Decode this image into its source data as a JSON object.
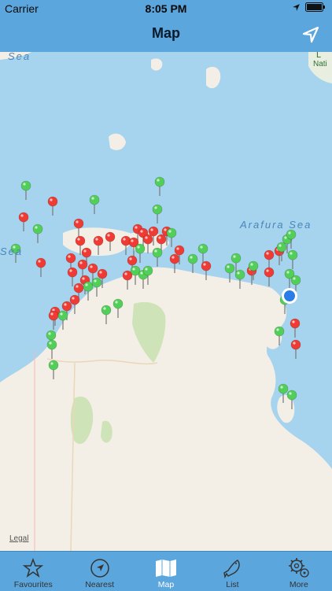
{
  "status": {
    "carrier": "Carrier",
    "time": "8:05 PM"
  },
  "nav": {
    "title": "Map"
  },
  "map": {
    "labels": {
      "sea_left": "Sea",
      "arafura": "Arafura Sea",
      "top_right_1": "L",
      "top_right_2": "Nati",
      "coast_mid": "Sea"
    },
    "legal": "Legal"
  },
  "tabs": [
    {
      "label": "Favourites",
      "icon": "star-icon"
    },
    {
      "label": "Nearest",
      "icon": "compass-icon"
    },
    {
      "label": "Map",
      "icon": "map-icon",
      "active": true
    },
    {
      "label": "List",
      "icon": "fish-icon"
    },
    {
      "label": "More",
      "icon": "gear-icon"
    }
  ],
  "colors": {
    "bar": "#5ba6dd",
    "sea": "#a6d3ee",
    "land": "#f4efe6",
    "pin_red": "#f03a34",
    "pin_green": "#52cf58"
  }
}
